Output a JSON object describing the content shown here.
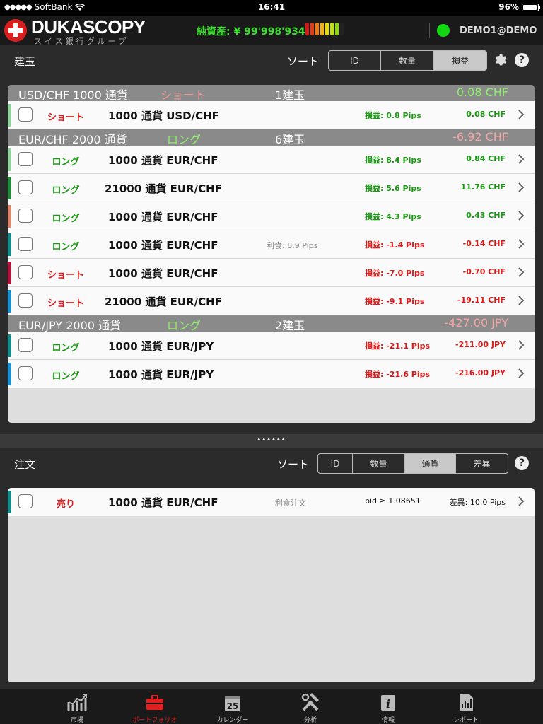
{
  "status_bar": {
    "carrier": "SoftBank",
    "time": "16:41",
    "battery": "96%"
  },
  "header": {
    "logo_text": "DUKASCOPY",
    "logo_sub": "スイス銀行グループ",
    "equity_label": "純資産: ¥ 99'998'934",
    "account": "DEMO1@DEMO",
    "meter_colors": [
      "#d31a1a",
      "#e63a12",
      "#f07a10",
      "#f3b010",
      "#e6d90c",
      "#bfe00c",
      "#8cd80f",
      "#222222"
    ],
    "connection_color": "#12d812"
  },
  "positions": {
    "title": "建玉",
    "sort_label": "ソート",
    "sort_options": [
      {
        "label": "ID",
        "selected": false
      },
      {
        "label": "数量",
        "selected": false
      },
      {
        "label": "損益",
        "selected": true
      }
    ],
    "groups": [
      {
        "title": "USD/CHF 1000 通貨",
        "side": "ショート",
        "count": "1建玉",
        "total": "0.08 CHF",
        "total_color": "#8df06a",
        "side_color": "#f29a9a",
        "rows": [
          {
            "stripe": "#8fd39b",
            "side": "ショート",
            "side_class": "r",
            "inst": "1000 通貨 USD/CHF",
            "tp": "",
            "pips": "損益: 0.8 Pips",
            "amt": "0.08 CHF",
            "pl_class": "g"
          }
        ]
      },
      {
        "title": "EUR/CHF 2000 通貨",
        "side": "ロング",
        "count": "6建玉",
        "total": "-6.92 CHF",
        "total_color": "#f3a4a4",
        "side_color": "#8df06a",
        "rows": [
          {
            "stripe": "#8fd39b",
            "side": "ロング",
            "side_class": "g",
            "inst": "1000 通貨 EUR/CHF",
            "tp": "",
            "pips": "損益: 8.4 Pips",
            "amt": "0.84 CHF",
            "pl_class": "g"
          },
          {
            "stripe": "#1f8a3a",
            "side": "ロング",
            "side_class": "g",
            "inst": "21000 通貨 EUR/CHF",
            "tp": "",
            "pips": "損益: 5.6 Pips",
            "amt": "11.76 CHF",
            "pl_class": "g"
          },
          {
            "stripe": "#d9896a",
            "side": "ロング",
            "side_class": "g",
            "inst": "1000 通貨 EUR/CHF",
            "tp": "",
            "pips": "損益: 4.3 Pips",
            "amt": "0.43 CHF",
            "pl_class": "g"
          },
          {
            "stripe": "#138a8a",
            "side": "ロング",
            "side_class": "g",
            "inst": "1000 通貨 EUR/CHF",
            "tp": "利食: 8.9 Pips",
            "pips": "損益: -1.4 Pips",
            "amt": "-0.14 CHF",
            "pl_class": "r"
          },
          {
            "stripe": "#b3123a",
            "side": "ショート",
            "side_class": "r",
            "inst": "1000 通貨 EUR/CHF",
            "tp": "",
            "pips": "損益: -7.0 Pips",
            "amt": "-0.70 CHF",
            "pl_class": "r"
          },
          {
            "stripe": "#1a8fd0",
            "side": "ショート",
            "side_class": "r",
            "inst": "21000 通貨 EUR/CHF",
            "tp": "",
            "pips": "損益: -9.1 Pips",
            "amt": "-19.11 CHF",
            "pl_class": "r"
          }
        ]
      },
      {
        "title": "EUR/JPY 2000 通貨",
        "side": "ロング",
        "count": "2建玉",
        "total": "-427.00 JPY",
        "total_color": "#f3a4a4",
        "side_color": "#8df06a",
        "rows": [
          {
            "stripe": "#138a8a",
            "side": "ロング",
            "side_class": "g",
            "inst": "1000 通貨 EUR/JPY",
            "tp": "",
            "pips": "損益: -21.1 Pips",
            "amt": "-211.00 JPY",
            "pl_class": "r"
          },
          {
            "stripe": "#1a8fd0",
            "side": "ロング",
            "side_class": "g",
            "inst": "1000 通貨 EUR/JPY",
            "tp": "",
            "pips": "損益: -21.6 Pips",
            "amt": "-216.00 JPY",
            "pl_class": "r"
          }
        ]
      }
    ]
  },
  "divider_handle": "••••••",
  "orders": {
    "title": "注文",
    "sort_label": "ソート",
    "sort_options": [
      {
        "label": "ID",
        "selected": false
      },
      {
        "label": "数量",
        "selected": false
      },
      {
        "label": "通貨",
        "selected": true
      },
      {
        "label": "差異",
        "selected": false
      }
    ],
    "rows": [
      {
        "stripe": "#138a8a",
        "side": "売り",
        "inst": "1000 通貨 EUR/CHF",
        "type": "利食注文",
        "cond": "bid ≥ 1.08651",
        "diff": "差異: 10.0 Pips"
      }
    ]
  },
  "tabs": [
    {
      "label": "市場",
      "icon": "chart-icon",
      "active": false
    },
    {
      "label": "ポートフォリオ",
      "icon": "briefcase-icon",
      "active": true
    },
    {
      "label": "カレンダー",
      "icon": "calendar-icon",
      "active": false,
      "icon_text": "25"
    },
    {
      "label": "分析",
      "icon": "tools-icon",
      "active": false
    },
    {
      "label": "情報",
      "icon": "info-icon",
      "active": false,
      "icon_text": "i"
    },
    {
      "label": "レポート",
      "icon": "report-icon",
      "active": false
    }
  ]
}
